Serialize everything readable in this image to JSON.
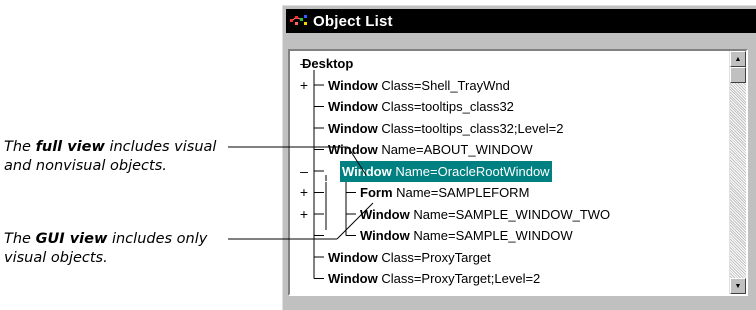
{
  "window": {
    "title": "Object List",
    "accent": "#008080",
    "titlebar_color": "#000000"
  },
  "callouts": {
    "full_view": {
      "prefix": "The ",
      "emphasis": "full view",
      "suffix": " includes visual and nonvisual objects."
    },
    "gui_view": {
      "prefix": "The ",
      "emphasis": "GUI view",
      "suffix": " includes only visual objects."
    }
  },
  "tree": {
    "rows": [
      {
        "expander": "–",
        "keyword": "Desktop",
        "detail": ""
      },
      {
        "expander": "+",
        "keyword": "Window",
        "detail": " Class=Shell_TrayWnd"
      },
      {
        "expander": "",
        "keyword": "Window",
        "detail": " Class=tooltips_class32"
      },
      {
        "expander": "",
        "keyword": "Window",
        "detail": " Class=tooltips_class32;Level=2"
      },
      {
        "expander": "",
        "keyword": "Window",
        "detail": " Name=ABOUT_WINDOW"
      },
      {
        "expander": "–",
        "keyword": "Window",
        "detail": " Name=OracleRootWindow",
        "selected": true
      },
      {
        "expander": "+",
        "keyword": "Form",
        "detail": " Name=SAMPLEFORM"
      },
      {
        "expander": "+",
        "keyword": "Window",
        "detail": " Name=SAMPLE_WINDOW_TWO"
      },
      {
        "expander": "",
        "keyword": "Window",
        "detail": " Name=SAMPLE_WINDOW"
      },
      {
        "expander": "",
        "keyword": "Window",
        "detail": " Class=ProxyTarget"
      },
      {
        "expander": "",
        "keyword": "Window",
        "detail": " Class=ProxyTarget;Level=2"
      }
    ]
  },
  "icons": {
    "title": "object-list-app-icon",
    "scroll_up": "scroll-up-arrow-icon",
    "scroll_down": "scroll-down-arrow-icon"
  }
}
